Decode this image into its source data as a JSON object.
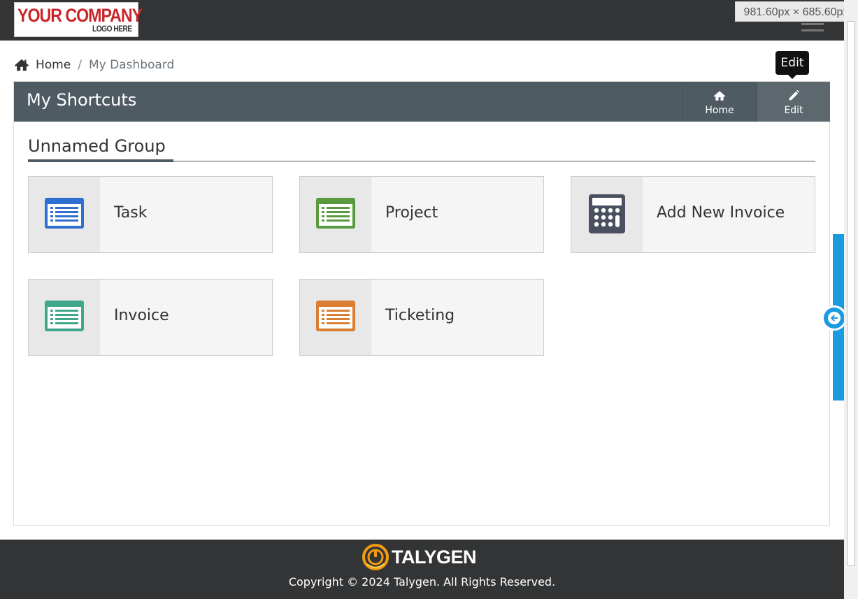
{
  "header": {
    "logo_main": "YOUR COMPANY",
    "logo_sub": "LOGO HERE",
    "viewport_label": "981.60px × 685.60px"
  },
  "breadcrumb": {
    "home": "Home",
    "separator": "/",
    "current": "My Dashboard"
  },
  "tooltip": {
    "text": "Edit"
  },
  "panel": {
    "title": "My Shortcuts",
    "buttons": {
      "home": "Home",
      "edit": "Edit"
    }
  },
  "group": {
    "title": "Unnamed Group",
    "tiles": [
      {
        "label": "Task",
        "icon": "list-icon",
        "color": "#2f6fd0"
      },
      {
        "label": "Project",
        "icon": "list-icon",
        "color": "#5a9a3e"
      },
      {
        "label": "Add New Invoice",
        "icon": "calculator-icon",
        "color": "#4a5060"
      },
      {
        "label": "Invoice",
        "icon": "list-icon",
        "color": "#3fa88a"
      },
      {
        "label": "Ticketing",
        "icon": "list-icon",
        "color": "#d97e33"
      }
    ]
  },
  "footer": {
    "brand": "TALYGEN",
    "copyright": "Copyright © 2024 Talygen. All Rights Reserved."
  },
  "colors": {
    "topbar": "#333436",
    "panel_header": "#4f5b62",
    "side_tab": "#1a9be0"
  }
}
